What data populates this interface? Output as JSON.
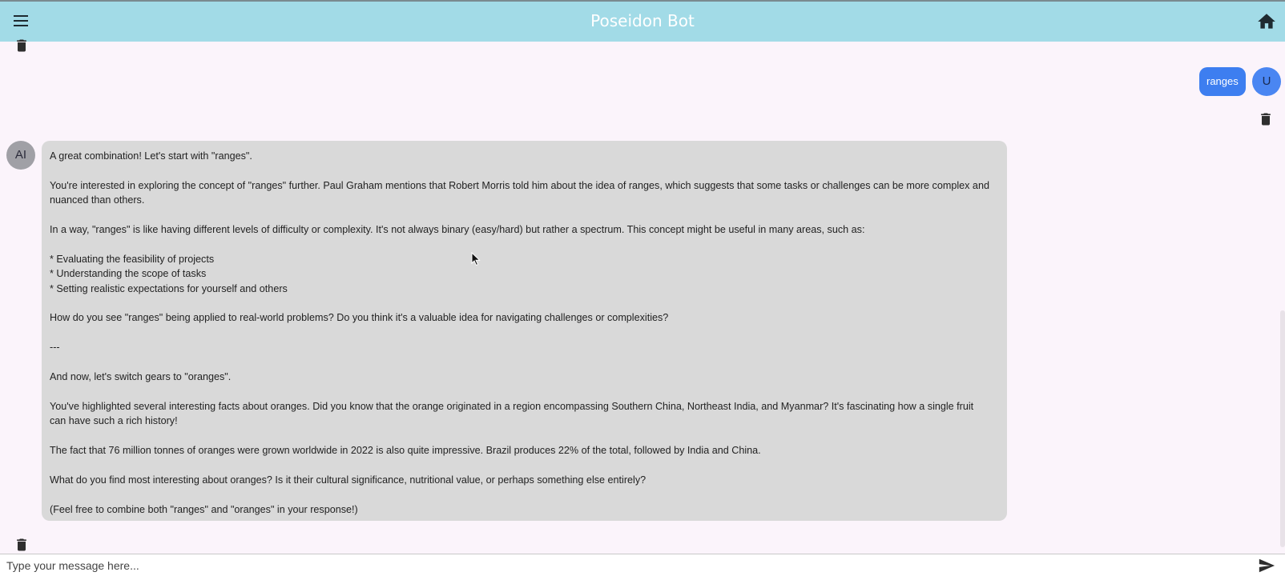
{
  "app": {
    "title": "Poseidon Bot",
    "header_color": "#a2dbe7",
    "background": "#fbf4fb"
  },
  "icons": {
    "menu": "menu-icon",
    "home": "home-icon",
    "delete": "trash-icon",
    "send": "send-icon"
  },
  "user_message": {
    "text": "ranges",
    "avatar": "U",
    "bubble_color": "#3d7ef0"
  },
  "ai_message": {
    "avatar": "AI",
    "bubble_color": "#d9d9d9",
    "paragraphs": [
      "A great combination! Let's start with \"ranges\".",
      "You're interested in exploring the concept of \"ranges\" further. Paul Graham mentions that Robert Morris told him about the idea of ranges, which suggests that some tasks or challenges can be more complex and nuanced than others.",
      "In a way, \"ranges\" is like having different levels of difficulty or complexity. It's not always binary (easy/hard) but rather a spectrum. This concept might be useful in many areas, such as:",
      "* Evaluating the feasibility of projects\n* Understanding the scope of tasks\n* Setting realistic expectations for yourself and others",
      "How do you see \"ranges\" being applied to real-world problems? Do you think it's a valuable idea for navigating challenges or complexities?",
      "---",
      "And now, let's switch gears to \"oranges\".",
      "You've highlighted several interesting facts about oranges. Did you know that the orange originated in a region encompassing Southern China, Northeast India, and Myanmar? It's fascinating how a single fruit can have such a rich history!",
      "The fact that 76 million tonnes of oranges were grown worldwide in 2022 is also quite impressive. Brazil produces 22% of the total, followed by India and China.",
      "What do you find most interesting about oranges? Is it their cultural significance, nutritional value, or perhaps something else entirely?",
      "(Feel free to combine both \"ranges\" and \"oranges\" in your response!)"
    ]
  },
  "composer": {
    "placeholder": "Type your message here...",
    "value": ""
  }
}
